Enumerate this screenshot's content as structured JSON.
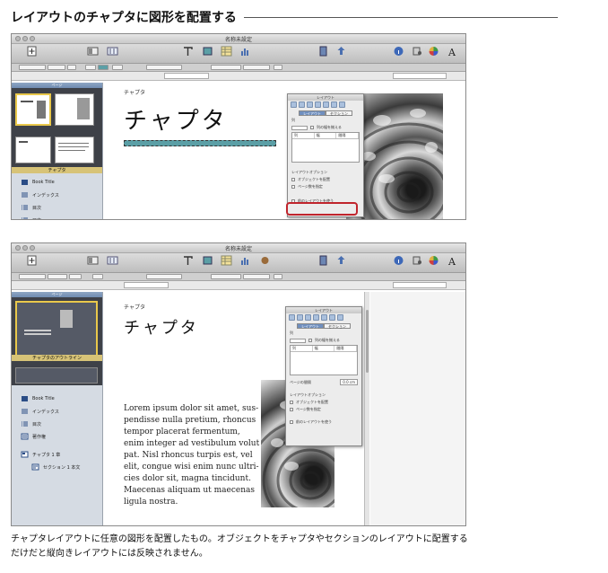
{
  "heading": "レイアウトのチャプタに図形を配置する",
  "window": {
    "title": "名称未設定",
    "toolbar": {
      "left_label": "",
      "view_labels": [
        "",
        ""
      ],
      "insert_labels": [
        "",
        "",
        "",
        ""
      ],
      "right_labels": [
        "",
        "",
        "",
        "",
        ""
      ]
    }
  },
  "screenshot1": {
    "sidebar_header": "ページ",
    "thumb_caption": "チャプタ",
    "sidebar_items": [
      {
        "label": "Book Title",
        "icon": "book-icon"
      },
      {
        "label": "インデックス",
        "icon": "index-icon"
      },
      {
        "label": "目次",
        "icon": "list-icon"
      },
      {
        "label": "目次",
        "icon": "list-icon"
      }
    ],
    "small_title": "チャプタ",
    "big_title": "チャプタ",
    "inspector": {
      "title": "レイアウト",
      "tabs": [
        "レイアウト",
        "セクション"
      ],
      "label1": "列",
      "check1": "列の幅を揃える",
      "table_headers": [
        "列",
        "幅",
        "間隔"
      ],
      "section_label": "レイアウトオプション",
      "option1": "オブジェクトを配置",
      "option2": "ページ数を指定",
      "highlighted_option": "前のレイアウトを使う"
    }
  },
  "screenshot2": {
    "sidebar_header": "ページ",
    "thumb_caption": "チャプタのアウトライン",
    "sidebar_items": [
      {
        "label": "Book Title",
        "icon": "book-icon",
        "indent": false
      },
      {
        "label": "インデックス",
        "icon": "index-icon",
        "indent": false
      },
      {
        "label": "目次",
        "icon": "list-icon",
        "indent": false
      },
      {
        "label": "著作権",
        "icon": "copyright-icon",
        "indent": false
      },
      {
        "label": "チャプタ 1 章",
        "icon": "chapter-icon",
        "indent": false
      },
      {
        "label": "セクション 1 本文",
        "icon": "section-icon",
        "indent": true
      }
    ],
    "small_title": "チャプタ",
    "big_title": "チャプタ",
    "body_lines": [
      "Lorem ipsum dolor sit amet, sus-",
      "pendisse nulla pretium, rhoncus",
      "tempor placerat fermentum,",
      "enim integer ad vestibulum volut",
      "pat. Nisl rhoncus turpis est, vel",
      "elit, congue wisi enim nunc ultri-",
      "cies dolor sit, magna tincidunt.",
      "Maecenas aliquam ut maecenas",
      "ligula nostra."
    ],
    "inspector": {
      "title": "レイアウト",
      "tabs": [
        "レイアウト",
        "セクション"
      ],
      "label1": "列",
      "check1": "列の幅を揃える",
      "table_headers": [
        "列",
        "幅",
        "間隔"
      ],
      "gutter_label": "ページの間隔",
      "gutter_value": "0.0 cm",
      "section_label": "レイアウトオプション",
      "option1": "オブジェクトを配置",
      "option2": "ページ数を指定",
      "highlighted_option": "前のレイアウトを使う"
    }
  },
  "caption": [
    "チャプタレイアウトに任意の図形を配置したもの。オブジェクトをチャプタやセクションのレイアウトに配置する",
    "だけだと縦向きレイアウトには反映されません。"
  ],
  "colors": {
    "teal_shape": "#5b9fa6",
    "highlight": "#c0242c",
    "selection": "#e9c84b"
  }
}
